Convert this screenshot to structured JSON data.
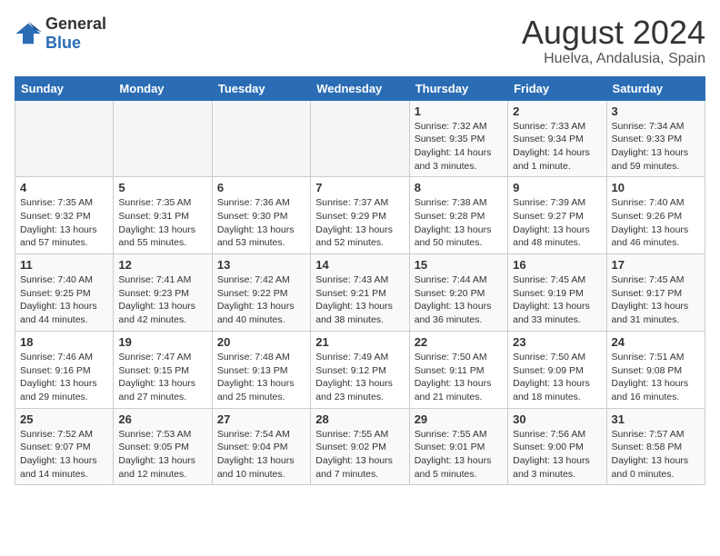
{
  "logo": {
    "line1": "General",
    "line2": "Blue"
  },
  "title": "August 2024",
  "subtitle": "Huelva, Andalusia, Spain",
  "weekdays": [
    "Sunday",
    "Monday",
    "Tuesday",
    "Wednesday",
    "Thursday",
    "Friday",
    "Saturday"
  ],
  "weeks": [
    [
      {
        "day": "",
        "info": ""
      },
      {
        "day": "",
        "info": ""
      },
      {
        "day": "",
        "info": ""
      },
      {
        "day": "",
        "info": ""
      },
      {
        "day": "1",
        "info": "Sunrise: 7:32 AM\nSunset: 9:35 PM\nDaylight: 14 hours\nand 3 minutes."
      },
      {
        "day": "2",
        "info": "Sunrise: 7:33 AM\nSunset: 9:34 PM\nDaylight: 14 hours\nand 1 minute."
      },
      {
        "day": "3",
        "info": "Sunrise: 7:34 AM\nSunset: 9:33 PM\nDaylight: 13 hours\nand 59 minutes."
      }
    ],
    [
      {
        "day": "4",
        "info": "Sunrise: 7:35 AM\nSunset: 9:32 PM\nDaylight: 13 hours\nand 57 minutes."
      },
      {
        "day": "5",
        "info": "Sunrise: 7:35 AM\nSunset: 9:31 PM\nDaylight: 13 hours\nand 55 minutes."
      },
      {
        "day": "6",
        "info": "Sunrise: 7:36 AM\nSunset: 9:30 PM\nDaylight: 13 hours\nand 53 minutes."
      },
      {
        "day": "7",
        "info": "Sunrise: 7:37 AM\nSunset: 9:29 PM\nDaylight: 13 hours\nand 52 minutes."
      },
      {
        "day": "8",
        "info": "Sunrise: 7:38 AM\nSunset: 9:28 PM\nDaylight: 13 hours\nand 50 minutes."
      },
      {
        "day": "9",
        "info": "Sunrise: 7:39 AM\nSunset: 9:27 PM\nDaylight: 13 hours\nand 48 minutes."
      },
      {
        "day": "10",
        "info": "Sunrise: 7:40 AM\nSunset: 9:26 PM\nDaylight: 13 hours\nand 46 minutes."
      }
    ],
    [
      {
        "day": "11",
        "info": "Sunrise: 7:40 AM\nSunset: 9:25 PM\nDaylight: 13 hours\nand 44 minutes."
      },
      {
        "day": "12",
        "info": "Sunrise: 7:41 AM\nSunset: 9:23 PM\nDaylight: 13 hours\nand 42 minutes."
      },
      {
        "day": "13",
        "info": "Sunrise: 7:42 AM\nSunset: 9:22 PM\nDaylight: 13 hours\nand 40 minutes."
      },
      {
        "day": "14",
        "info": "Sunrise: 7:43 AM\nSunset: 9:21 PM\nDaylight: 13 hours\nand 38 minutes."
      },
      {
        "day": "15",
        "info": "Sunrise: 7:44 AM\nSunset: 9:20 PM\nDaylight: 13 hours\nand 36 minutes."
      },
      {
        "day": "16",
        "info": "Sunrise: 7:45 AM\nSunset: 9:19 PM\nDaylight: 13 hours\nand 33 minutes."
      },
      {
        "day": "17",
        "info": "Sunrise: 7:45 AM\nSunset: 9:17 PM\nDaylight: 13 hours\nand 31 minutes."
      }
    ],
    [
      {
        "day": "18",
        "info": "Sunrise: 7:46 AM\nSunset: 9:16 PM\nDaylight: 13 hours\nand 29 minutes."
      },
      {
        "day": "19",
        "info": "Sunrise: 7:47 AM\nSunset: 9:15 PM\nDaylight: 13 hours\nand 27 minutes."
      },
      {
        "day": "20",
        "info": "Sunrise: 7:48 AM\nSunset: 9:13 PM\nDaylight: 13 hours\nand 25 minutes."
      },
      {
        "day": "21",
        "info": "Sunrise: 7:49 AM\nSunset: 9:12 PM\nDaylight: 13 hours\nand 23 minutes."
      },
      {
        "day": "22",
        "info": "Sunrise: 7:50 AM\nSunset: 9:11 PM\nDaylight: 13 hours\nand 21 minutes."
      },
      {
        "day": "23",
        "info": "Sunrise: 7:50 AM\nSunset: 9:09 PM\nDaylight: 13 hours\nand 18 minutes."
      },
      {
        "day": "24",
        "info": "Sunrise: 7:51 AM\nSunset: 9:08 PM\nDaylight: 13 hours\nand 16 minutes."
      }
    ],
    [
      {
        "day": "25",
        "info": "Sunrise: 7:52 AM\nSunset: 9:07 PM\nDaylight: 13 hours\nand 14 minutes."
      },
      {
        "day": "26",
        "info": "Sunrise: 7:53 AM\nSunset: 9:05 PM\nDaylight: 13 hours\nand 12 minutes."
      },
      {
        "day": "27",
        "info": "Sunrise: 7:54 AM\nSunset: 9:04 PM\nDaylight: 13 hours\nand 10 minutes."
      },
      {
        "day": "28",
        "info": "Sunrise: 7:55 AM\nSunset: 9:02 PM\nDaylight: 13 hours\nand 7 minutes."
      },
      {
        "day": "29",
        "info": "Sunrise: 7:55 AM\nSunset: 9:01 PM\nDaylight: 13 hours\nand 5 minutes."
      },
      {
        "day": "30",
        "info": "Sunrise: 7:56 AM\nSunset: 9:00 PM\nDaylight: 13 hours\nand 3 minutes."
      },
      {
        "day": "31",
        "info": "Sunrise: 7:57 AM\nSunset: 8:58 PM\nDaylight: 13 hours\nand 0 minutes."
      }
    ]
  ]
}
